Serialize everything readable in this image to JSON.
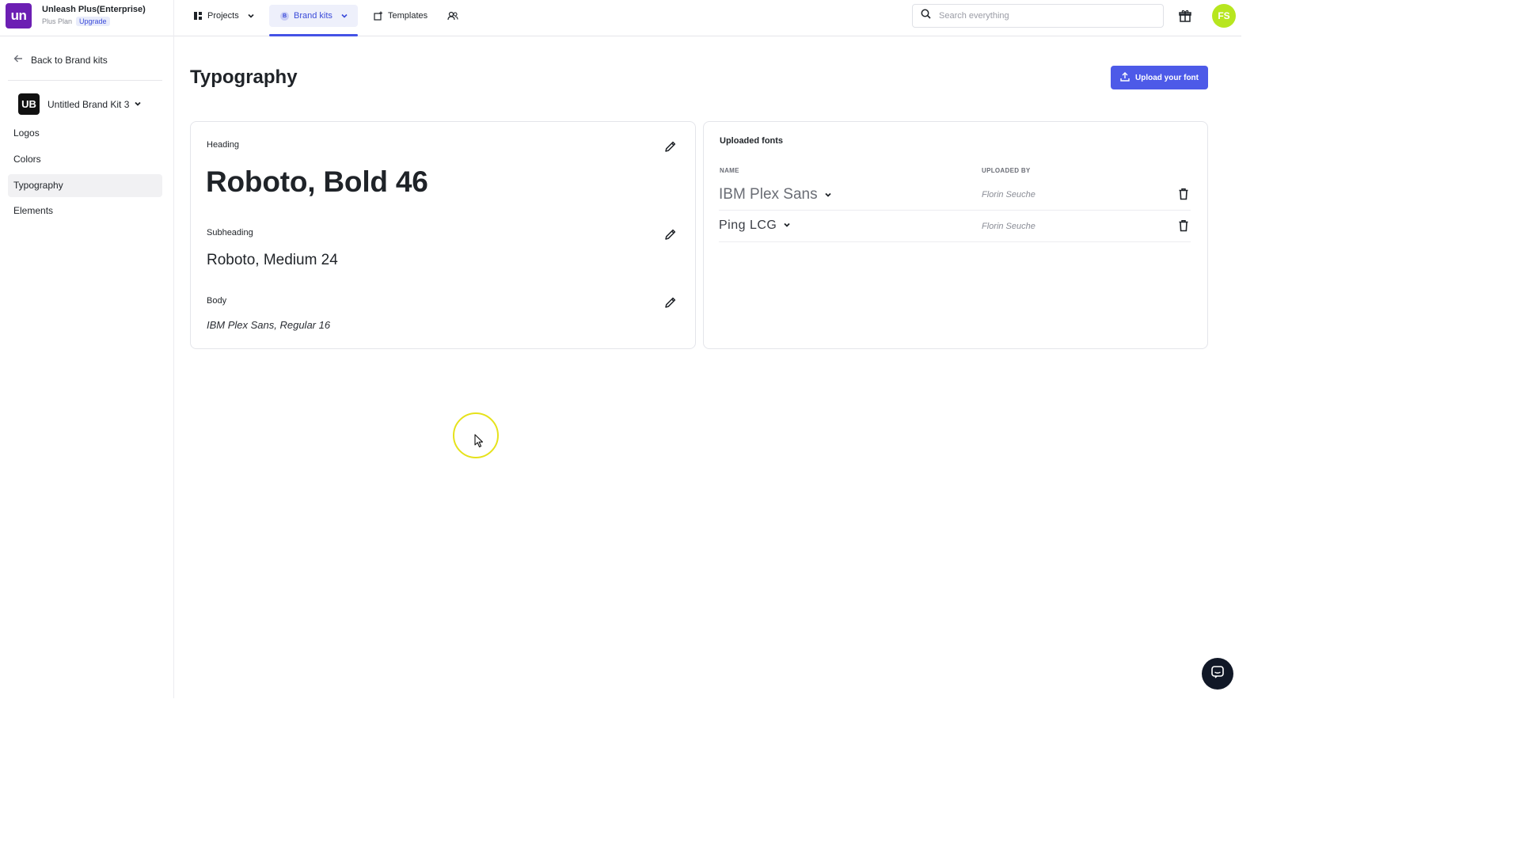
{
  "org": {
    "logo_text": "un",
    "name": "Unleash Plus(Enterprise)",
    "plan": "Plus Plan",
    "upgrade_label": "Upgrade"
  },
  "nav": {
    "projects": "Projects",
    "brand_kits": "Brand kits",
    "brand_kit_mini_icon": "B",
    "templates": "Templates"
  },
  "search": {
    "placeholder": "Search everything"
  },
  "user": {
    "initials": "FS"
  },
  "sidebar": {
    "back_label": "Back to Brand kits",
    "kit_badge": "UB",
    "kit_name": "Untitled Brand Kit 3",
    "items": [
      {
        "label": "Logos"
      },
      {
        "label": "Colors"
      },
      {
        "label": "Typography",
        "active": true
      },
      {
        "label": "Elements"
      }
    ]
  },
  "main": {
    "title": "Typography",
    "upload_button": "Upload your font",
    "styles": {
      "heading_label": "Heading",
      "heading_value": "Roboto, Bold 46",
      "subheading_label": "Subheading",
      "subheading_value": "Roboto, Medium 24",
      "body_label": "Body",
      "body_value": "IBM Plex Sans, Regular 16"
    },
    "uploaded_fonts": {
      "title": "Uploaded fonts",
      "col_name": "NAME",
      "col_uploaded_by": "UPLOADED BY",
      "rows": [
        {
          "name": "IBM Plex Sans",
          "uploaded_by": "Florin Seuche"
        },
        {
          "name": "Ping LCG",
          "uploaded_by": "Florin Seuche"
        }
      ]
    }
  },
  "colors": {
    "brand_purple": "#6c1fb3",
    "accent_blue": "#4d5ae8",
    "avatar_green": "#b7e61f",
    "cursor_ring": "#e6e21b"
  }
}
